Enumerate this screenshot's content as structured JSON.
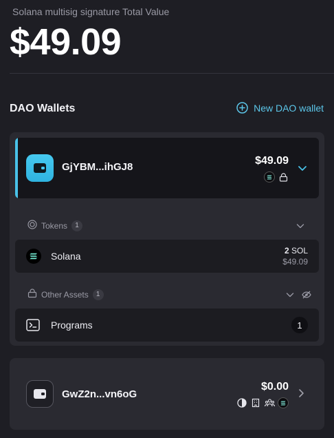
{
  "header": {
    "total_label": "Solana multisig signature Total Value",
    "total_value": "$49.09"
  },
  "section": {
    "title": "DAO Wallets",
    "new_wallet_label": "New DAO wallet"
  },
  "wallets": [
    {
      "name": "GjYBM...ihGJ8",
      "amount": "$49.09",
      "expanded": true,
      "badges": [
        "solana-icon",
        "lock-icon"
      ],
      "tokens": {
        "label": "Tokens",
        "count": "1",
        "items": [
          {
            "name": "Solana",
            "amount": "2",
            "unit": "SOL",
            "usd": "$49.09"
          }
        ]
      },
      "other_assets": {
        "label": "Other Assets",
        "count": "1",
        "items": [
          {
            "name": "Programs",
            "count": "1"
          }
        ]
      }
    },
    {
      "name": "GwZ2n...vn6oG",
      "amount": "$0.00",
      "expanded": false,
      "badges": [
        "half-circle-icon",
        "building-icon",
        "people-icon",
        "solana-icon"
      ]
    }
  ],
  "colors": {
    "accent": "#49c2e8",
    "background": "#1e1e24",
    "card": "#2a2a31"
  }
}
